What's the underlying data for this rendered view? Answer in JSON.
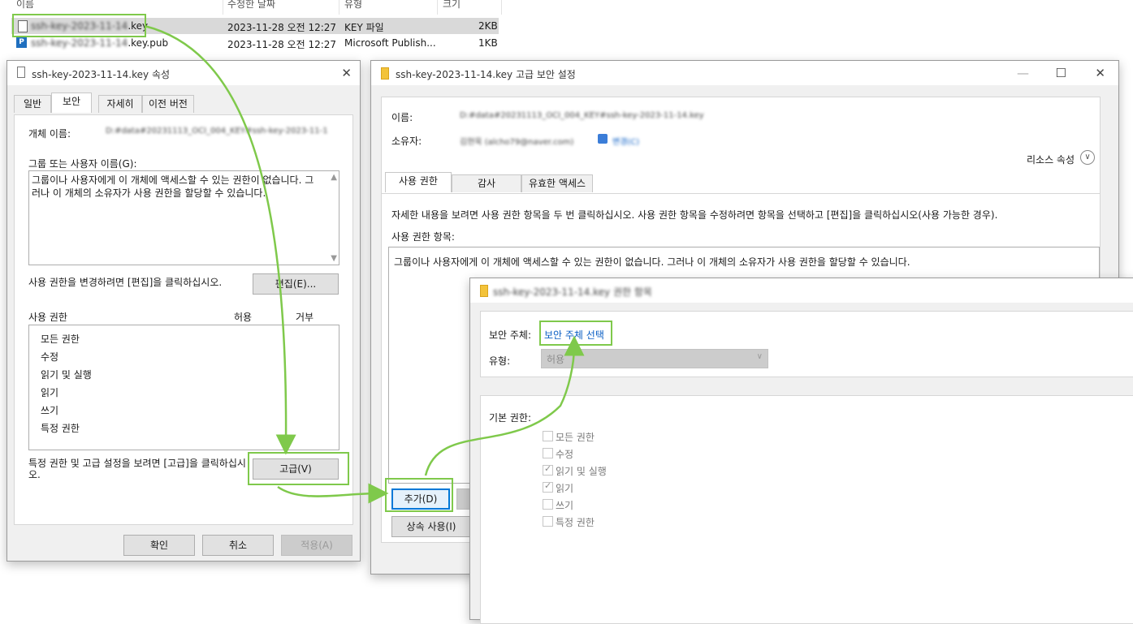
{
  "explorer": {
    "headers": {
      "name": "이름",
      "date": "수정한 날짜",
      "type": "유형",
      "size": "크기"
    },
    "rows": [
      {
        "name_blur": "ssh-key-2023-11-14",
        "name_ext": ".key",
        "date": "2023-11-28 오전 12:27",
        "type": "KEY 파일",
        "size": "2KB"
      },
      {
        "name_blur": "ssh-key-2023-11-14",
        "name_ext": ".key.pub",
        "date": "2023-11-28 오전 12:27",
        "type": "Microsoft Publish...",
        "size": "1KB"
      }
    ]
  },
  "props": {
    "title": "ssh-key-2023-11-14.key 속성",
    "tabs": [
      "일반",
      "보안",
      "자세히",
      "이전 버전"
    ],
    "object_name_label": "개체 이름:",
    "object_name_value": "D:#data#20231113_OCI_004_KEY#ssh-key-2023-11-1",
    "group_label": "그룹 또는 사용자 이름(G):",
    "group_text": "그룹이나 사용자에게 이 개체에 액세스할 수 있는 권한이 없습니다. 그러나 이 개체의 소유자가 사용 권한을 할당할 수 있습니다.",
    "change_hint": "사용 권한을 변경하려면 [편집]을 클릭하십시오.",
    "edit_button": "편집(E)...",
    "perm_header": "사용 권한",
    "allow_header": "허용",
    "deny_header": "거부",
    "permissions": [
      "모든 권한",
      "수정",
      "읽기 및 실행",
      "읽기",
      "쓰기",
      "특정 권한"
    ],
    "advanced_hint": "특정 권한 및 고급 설정을 보려면 [고급]을 클릭하십시오.",
    "advanced_button": "고급(V)",
    "ok_button": "확인",
    "cancel_button": "취소",
    "apply_button": "적용(A)"
  },
  "advanced": {
    "title": "ssh-key-2023-11-14.key 고급 보안 설정",
    "name_label": "이름:",
    "name_value": "D:#data#20231113_OCI_004_KEY#ssh-key-2023-11-14.key",
    "owner_label": "소유자:",
    "owner_value": "김현욱 (alcho79@naver.com)",
    "owner_change": "변경(C)",
    "resource_props": "리소스 속성",
    "tabs": [
      "사용 권한",
      "감사",
      "유효한 액세스"
    ],
    "info": "자세한 내용을 보려면 사용 권한 항목을 두 번 클릭하십시오. 사용 권한 항목을 수정하려면 항목을 선택하고 [편집]을 클릭하십시오(사용 가능한 경우).",
    "entries_label": "사용 권한 항목:",
    "entries_text": "그룹이나 사용자에게 이 개체에 액세스할 수 있는 권한이 없습니다. 그러나 이 개체의 소유자가 사용 권한을 할당할 수 있습니다.",
    "add_button": "추가(D)",
    "inherit_button": "상속 사용(I)"
  },
  "entry": {
    "title": "ssh-key-2023-11-14.key 권한 항목",
    "principal_label": "보안 주체:",
    "principal_link": "보안 주체 선택",
    "type_label": "유형:",
    "type_value": "허용",
    "basic_label": "기본 권한:",
    "basic_perms": [
      {
        "label": "모든 권한",
        "checked": false
      },
      {
        "label": "수정",
        "checked": false
      },
      {
        "label": "읽기 및 실행",
        "checked": true
      },
      {
        "label": "읽기",
        "checked": true
      },
      {
        "label": "쓰기",
        "checked": false
      },
      {
        "label": "특정 권한",
        "checked": false
      }
    ]
  },
  "colors": {
    "highlight": "#7fc94b",
    "link": "#0a5ec4",
    "accent": "#0078d7"
  }
}
